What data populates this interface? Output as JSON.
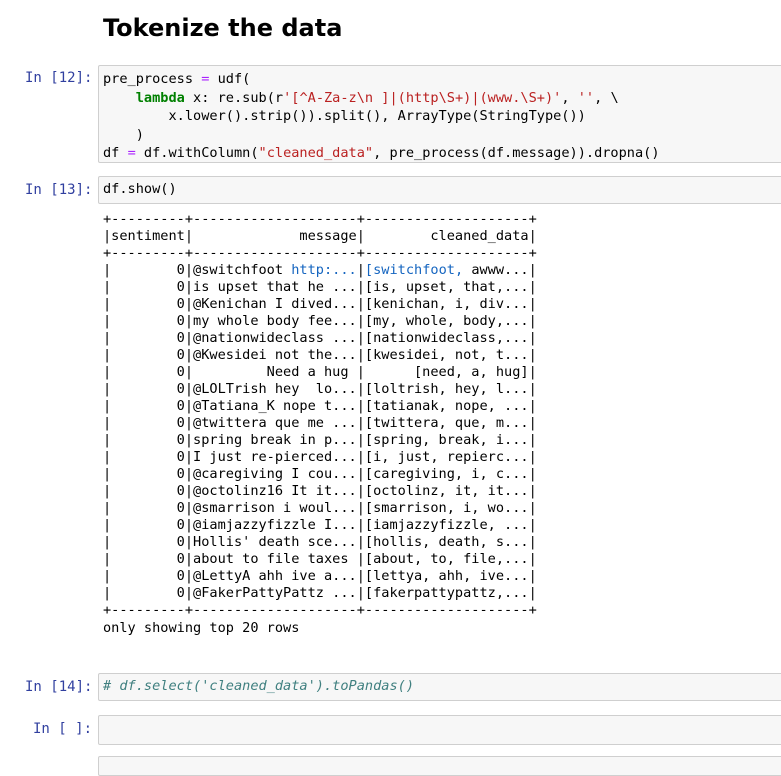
{
  "heading": "Tokenize the data",
  "cells": [
    {
      "prompt": "In [12]:",
      "lines": [
        [
          {
            "t": "pre_process "
          },
          {
            "t": "=",
            "c": "op"
          },
          {
            "t": " udf("
          }
        ],
        [
          {
            "t": "    "
          },
          {
            "t": "lambda",
            "c": "kw"
          },
          {
            "t": " x: re.sub(r"
          },
          {
            "t": "'[^A-Za-z\\n ]|(http\\S+)|(www.\\S+)'",
            "c": "str"
          },
          {
            "t": ", "
          },
          {
            "t": "''",
            "c": "str"
          },
          {
            "t": ", \\"
          }
        ],
        [
          {
            "t": "        x.lower().strip()).split(), ArrayType(StringType())"
          }
        ],
        [
          {
            "t": "    )"
          }
        ],
        [
          {
            "t": "df "
          },
          {
            "t": "=",
            "c": "op"
          },
          {
            "t": " df.withColumn("
          },
          {
            "t": "\"cleaned_data\"",
            "c": "str"
          },
          {
            "t": ", pre_process(df.message)).dropna()"
          }
        ]
      ]
    },
    {
      "prompt": "In [13]:",
      "lines": [
        [
          {
            "t": "df.show()"
          }
        ]
      ]
    },
    {
      "prompt": "In [14]:",
      "lines": [
        [
          {
            "t": "# df.select('cleaned_data').toPandas()",
            "c": "cm"
          }
        ]
      ]
    },
    {
      "prompt": "In [ ]:",
      "lines": []
    }
  ],
  "output": {
    "border": "+---------+--------------------+--------------------+",
    "header_line": "|sentiment|             message|        cleaned_data|",
    "rows": [
      [
        {
          "t": "|        0|@switchfoot "
        },
        {
          "t": "http:...",
          "c": "link"
        },
        {
          "t": "|"
        },
        {
          "t": "[switchfoot,",
          "c": "link"
        },
        {
          "t": " awww...|"
        }
      ],
      [
        {
          "t": "|        0|is upset that he ...|[is, upset, that,...|"
        }
      ],
      [
        {
          "t": "|        0|@Kenichan I dived...|[kenichan, i, div...|"
        }
      ],
      [
        {
          "t": "|        0|my whole body fee...|[my, whole, body,...|"
        }
      ],
      [
        {
          "t": "|        0|@nationwideclass ...|[nationwideclass,...|"
        }
      ],
      [
        {
          "t": "|        0|@Kwesidei not the...|[kwesidei, not, t...|"
        }
      ],
      [
        {
          "t": "|        0|         Need a hug |      [need, a, hug]|"
        }
      ],
      [
        {
          "t": "|        0|@LOLTrish hey  lo...|[loltrish, hey, l...|"
        }
      ],
      [
        {
          "t": "|        0|@Tatiana_K nope t...|[tatianak, nope, ...|"
        }
      ],
      [
        {
          "t": "|        0|@twittera que me ...|[twittera, que, m...|"
        }
      ],
      [
        {
          "t": "|        0|spring break in p...|[spring, break, i...|"
        }
      ],
      [
        {
          "t": "|        0|I just re-pierced...|[i, just, repierc...|"
        }
      ],
      [
        {
          "t": "|        0|@caregiving I cou...|[caregiving, i, c...|"
        }
      ],
      [
        {
          "t": "|        0|@octolinz16 It it...|[octolinz, it, it...|"
        }
      ],
      [
        {
          "t": "|        0|@smarrison i woul...|[smarrison, i, wo...|"
        }
      ],
      [
        {
          "t": "|        0|@iamjazzyfizzle I...|[iamjazzyfizzle, ...|"
        }
      ],
      [
        {
          "t": "|        0|Hollis' death sce...|[hollis, death, s...|"
        }
      ],
      [
        {
          "t": "|        0|about to file taxes |[about, to, file,...|"
        }
      ],
      [
        {
          "t": "|        0|@LettyA ahh ive a...|[lettya, ahh, ive...|"
        }
      ],
      [
        {
          "t": "|        0|@FakerPattyPattz ...|[fakerpattypattz,...|"
        }
      ]
    ],
    "note": "only showing top 20 rows"
  },
  "colors": {
    "prompt": "#303f9f",
    "input_bg": "#f7f7f7",
    "input_border": "#cfcfcf",
    "keyword": "#008000",
    "operator": "#aa22ff",
    "string": "#ba2121",
    "comment": "#408080",
    "link": "#1565c0"
  }
}
